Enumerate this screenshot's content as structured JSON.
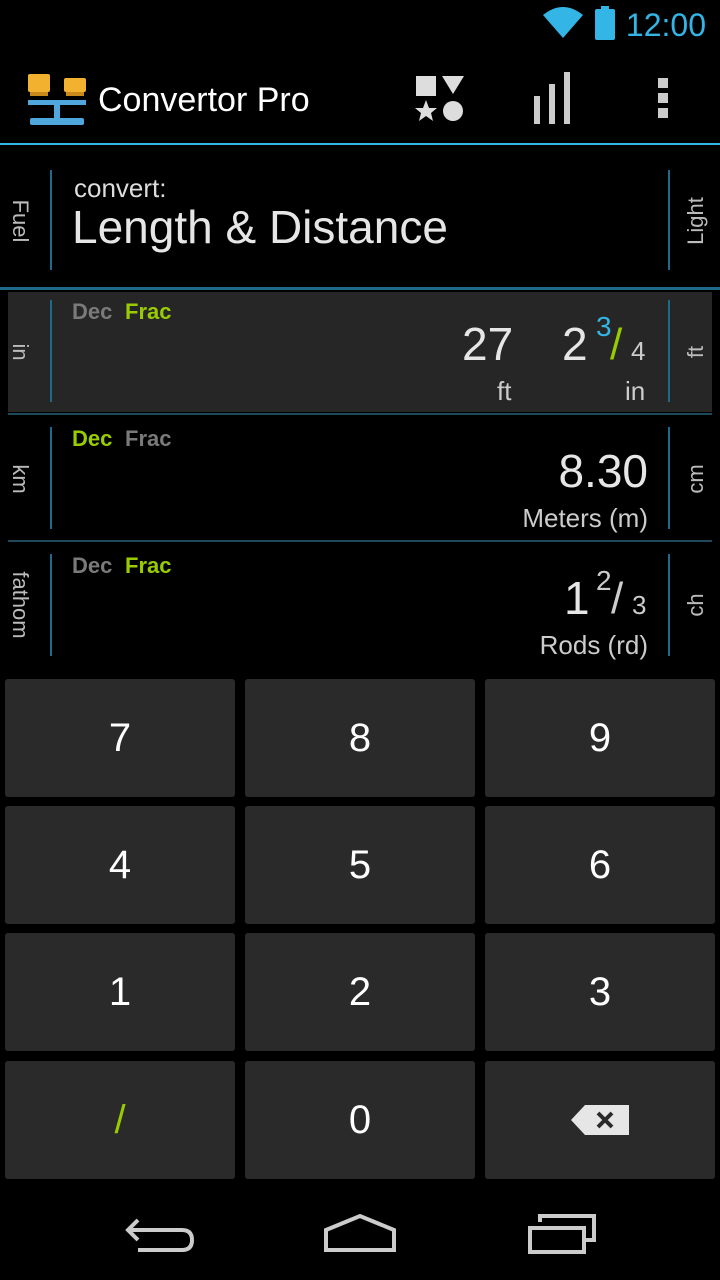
{
  "status": {
    "time": "12:00"
  },
  "app": {
    "title": "Convertor Pro"
  },
  "category": {
    "left_label": "Fuel",
    "right_label": "Light",
    "prefix": "convert:",
    "name": "Length & Distance"
  },
  "rows": [
    {
      "left_label": "in",
      "right_label": "ft",
      "mode_dec": "Dec",
      "mode_frac": "Frac",
      "active_mode": "Frac",
      "value_a": "27",
      "unit_a": "ft",
      "value_b_whole": "2",
      "value_b_num": "3",
      "value_b_slash": "/",
      "value_b_den": "4",
      "unit_b": "in"
    },
    {
      "left_label": "km",
      "right_label": "cm",
      "mode_dec": "Dec",
      "mode_frac": "Frac",
      "active_mode": "Dec",
      "value": "8.30",
      "unit": "Meters (m)"
    },
    {
      "left_label": "fathom",
      "right_label": "ch",
      "mode_dec": "Dec",
      "mode_frac": "Frac",
      "active_mode": "Frac",
      "value_whole": "1",
      "value_num": "2",
      "value_slash": "/",
      "value_den": "3",
      "unit": "Rods (rd)"
    }
  ],
  "keypad": {
    "k7": "7",
    "k8": "8",
    "k9": "9",
    "k4": "4",
    "k5": "5",
    "k6": "6",
    "k1": "1",
    "k2": "2",
    "k3": "3",
    "kslash": "/",
    "k0": "0",
    "kback_icon": "backspace-icon"
  },
  "colors": {
    "accent_blue": "#33b5e5",
    "accent_green": "#99cc00",
    "key_bg": "#2a2a2a",
    "active_row_bg": "#262626"
  },
  "icons": [
    "wifi-icon",
    "battery-icon",
    "app-logo-icon",
    "shapes-icon",
    "bar-chart-icon",
    "overflow-menu-icon",
    "back-icon",
    "home-icon",
    "recents-icon"
  ]
}
